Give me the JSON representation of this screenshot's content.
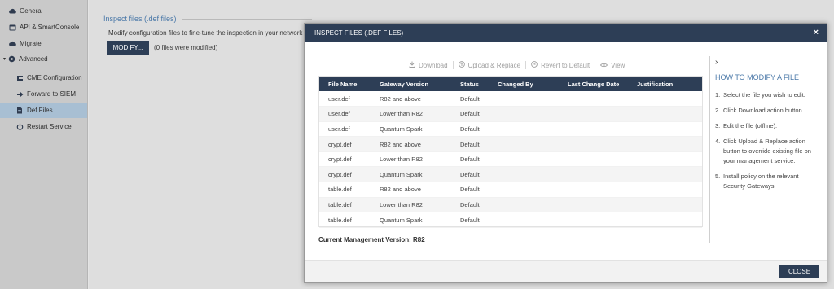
{
  "sidebar": {
    "items": [
      {
        "label": "General",
        "icon": "cloud-icon"
      },
      {
        "label": "API & SmartConsole",
        "icon": "window-icon"
      },
      {
        "label": "Migrate",
        "icon": "cloud-icon"
      },
      {
        "label": "Advanced",
        "icon": "gear-icon",
        "expanded": true
      },
      {
        "label": "CME Configuration",
        "icon": "cme-icon"
      },
      {
        "label": "Forward to SIEM",
        "icon": "forward-icon"
      },
      {
        "label": "Def Files",
        "icon": "file-icon",
        "active": true
      },
      {
        "label": "Restart Service",
        "icon": "power-icon"
      }
    ]
  },
  "main": {
    "section_title": "Inspect files (.def files)",
    "description": "Modify configuration files to fine-tune the inspection in your network",
    "modify_label": "MODIFY...",
    "modified_note": "(0 files were modified)"
  },
  "modal": {
    "title": "INSPECT FILES (.DEF FILES)",
    "close_x": "×",
    "toolbar": {
      "download": "Download",
      "upload_replace": "Upload & Replace",
      "revert": "Revert to Default",
      "view": "View"
    },
    "table": {
      "columns": [
        "File Name",
        "Gateway Version",
        "Status",
        "Changed By",
        "Last Change Date",
        "Justification"
      ],
      "rows": [
        [
          "user.def",
          "R82 and above",
          "Default",
          "",
          "",
          ""
        ],
        [
          "user.def",
          "Lower than R82",
          "Default",
          "",
          "",
          ""
        ],
        [
          "user.def",
          "Quantum Spark",
          "Default",
          "",
          "",
          ""
        ],
        [
          "crypt.def",
          "R82 and above",
          "Default",
          "",
          "",
          ""
        ],
        [
          "crypt.def",
          "Lower than R82",
          "Default",
          "",
          "",
          ""
        ],
        [
          "crypt.def",
          "Quantum Spark",
          "Default",
          "",
          "",
          ""
        ],
        [
          "table.def",
          "R82 and above",
          "Default",
          "",
          "",
          ""
        ],
        [
          "table.def",
          "Lower than R82",
          "Default",
          "",
          "",
          ""
        ],
        [
          "table.def",
          "Quantum Spark",
          "Default",
          "",
          "",
          ""
        ]
      ]
    },
    "management_version": "Current Management Version: R82",
    "help": {
      "chevron": "›",
      "title": "HOW TO MODIFY A FILE",
      "steps": [
        {
          "n": "1.",
          "text": "Select the file you wish to edit."
        },
        {
          "n": "2.",
          "text": "Click Download action button."
        },
        {
          "n": "3.",
          "text": "Edit the file (offline)."
        },
        {
          "n": "4.",
          "text": "Click Upload & Replace action button to override existing file on your management service."
        },
        {
          "n": "5.",
          "text": "Install policy on the relevant Security Gateways."
        }
      ]
    },
    "close_label": "CLOSE"
  },
  "colors": {
    "header_navy": "#2d3e56",
    "accent_blue": "#4a78a8",
    "sidebar_active": "#a8bfd3"
  }
}
